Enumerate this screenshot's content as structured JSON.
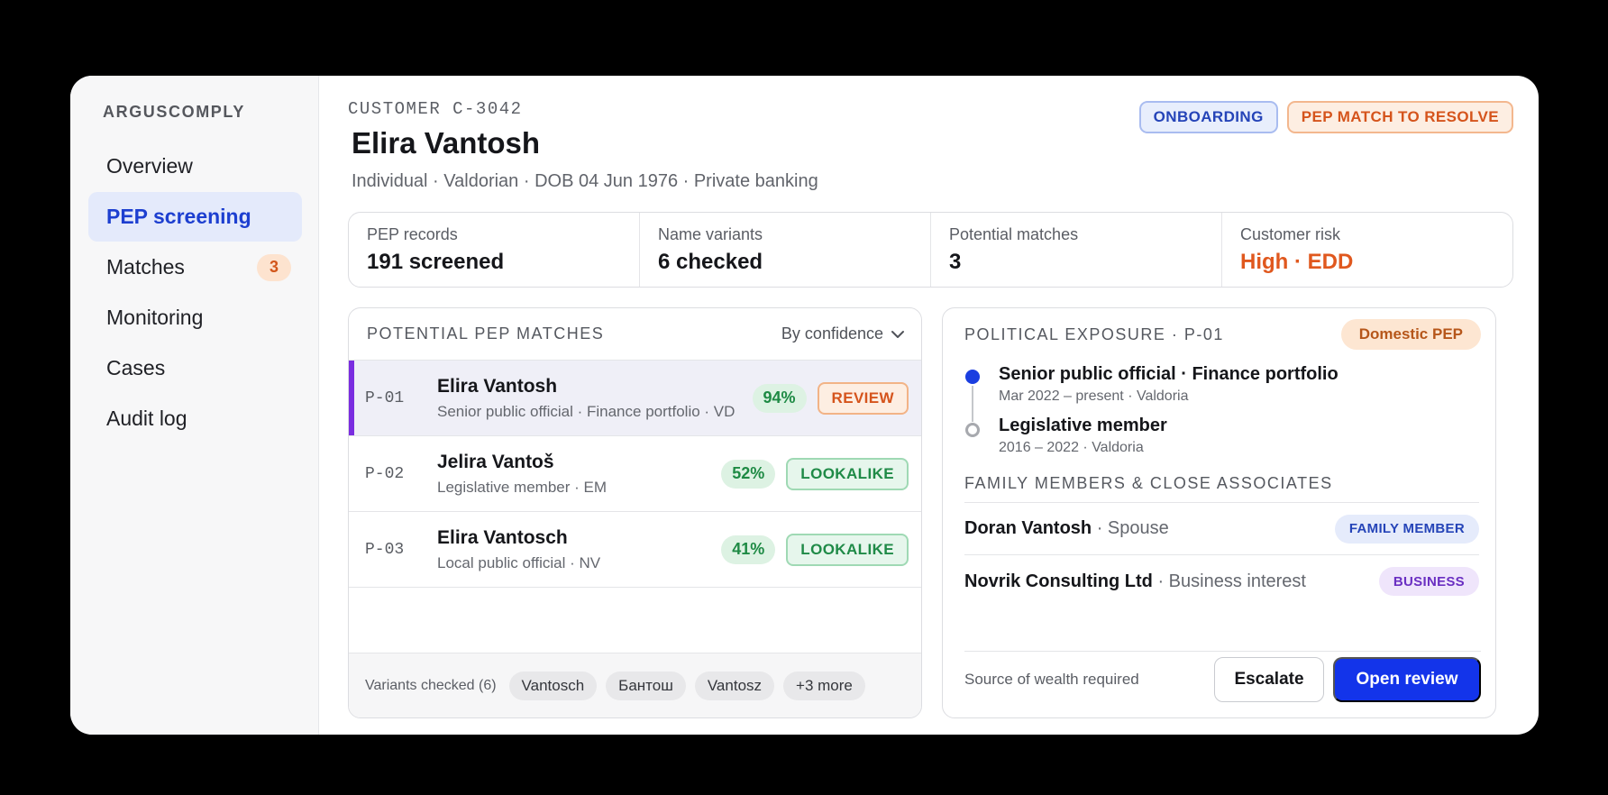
{
  "brand": "ARGUSCOMPLY",
  "sidebar": {
    "items": [
      {
        "label": "Overview"
      },
      {
        "label": "PEP screening",
        "active": true
      },
      {
        "label": "Matches",
        "badge": "3"
      },
      {
        "label": "Monitoring"
      },
      {
        "label": "Cases"
      },
      {
        "label": "Audit log"
      }
    ]
  },
  "customer": {
    "eyebrow": "CUSTOMER C-3042",
    "name": "Elira Vantosh",
    "meta": "Individual · Valdorian · DOB 04 Jun 1976 · Private banking"
  },
  "tags": {
    "onboarding": "ONBOARDING",
    "pep": "PEP MATCH TO RESOLVE"
  },
  "stats": [
    {
      "label": "PEP records",
      "value": "191 screened"
    },
    {
      "label": "Name variants",
      "value": "6 checked"
    },
    {
      "label": "Potential matches",
      "value": "3"
    },
    {
      "label": "Customer risk",
      "value": "High · EDD"
    }
  ],
  "matches": {
    "title": "POTENTIAL PEP MATCHES",
    "sort_label": "By confidence",
    "rows": [
      {
        "id": "P-01",
        "name": "Elira Vantosh",
        "desc": "Senior public official · Finance portfolio · VD",
        "score": "94%",
        "status": "REVIEW"
      },
      {
        "id": "P-02",
        "name": "Jelira Vantoš",
        "desc": "Legislative member · EM",
        "score": "52%",
        "status": "LOOKALIKE"
      },
      {
        "id": "P-03",
        "name": "Elira Vantosch",
        "desc": "Local public official · NV",
        "score": "41%",
        "status": "LOOKALIKE"
      }
    ],
    "variants_label": "Variants checked (6)",
    "variants": [
      "Vantosch",
      "Бантош",
      "Vantosz",
      "+3 more"
    ]
  },
  "exposure": {
    "title": "POLITICAL EXPOSURE · P-01",
    "tag": "Domestic PEP",
    "timeline": [
      {
        "title": "Senior public official · Finance portfolio",
        "sub": "Mar 2022 – present · Valdoria"
      },
      {
        "title": "Legislative member",
        "sub": "2016 – 2022 · Valdoria"
      }
    ],
    "family_title": "FAMILY MEMBERS & CLOSE ASSOCIATES",
    "family": [
      {
        "name": "Doran Vantosh",
        "rel": " · Spouse",
        "tag": "FAMILY MEMBER"
      },
      {
        "name": "Novrik Consulting Ltd",
        "rel": " · Business interest",
        "tag": "BUSINESS"
      }
    ],
    "footer_note": "Source of wealth required",
    "escalate_label": "Escalate",
    "open_label": "Open review"
  }
}
